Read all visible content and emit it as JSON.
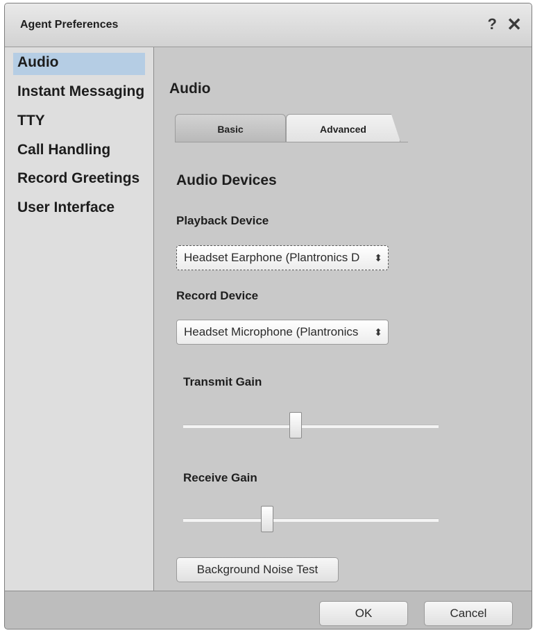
{
  "window": {
    "title": "Agent Preferences",
    "help_label": "?",
    "close_label": "✕"
  },
  "sidebar": {
    "items": [
      {
        "label": "Audio"
      },
      {
        "label": "Instant Messaging"
      },
      {
        "label": "TTY"
      },
      {
        "label": "Call Handling"
      },
      {
        "label": "Record Greetings"
      },
      {
        "label": "User Interface"
      }
    ],
    "selected": "Audio"
  },
  "main": {
    "title": "Audio",
    "tabs": [
      {
        "label": "Basic"
      },
      {
        "label": "Advanced"
      }
    ],
    "active_tab": "Advanced",
    "section_title": "Audio Devices",
    "playback": {
      "label": "Playback Device",
      "value": "Headset Earphone (Plantronics D"
    },
    "record": {
      "label": "Record Device",
      "value": "Headset Microphone (Plantronics"
    },
    "transmit_gain": {
      "label": "Transmit Gain",
      "level": 0.44
    },
    "receive_gain": {
      "label": "Receive Gain",
      "level": 0.33
    },
    "noise_test_label": "Background Noise Test"
  },
  "footer": {
    "ok_label": "OK",
    "cancel_label": "Cancel"
  },
  "icons": {
    "help": "question-mark-icon",
    "close": "close-icon",
    "select_arrow": "up-down-arrows-icon"
  },
  "colors": {
    "selection": "#b5cde4",
    "dialog_bg": "#c9c9c9",
    "sidebar_bg": "#dedede"
  }
}
